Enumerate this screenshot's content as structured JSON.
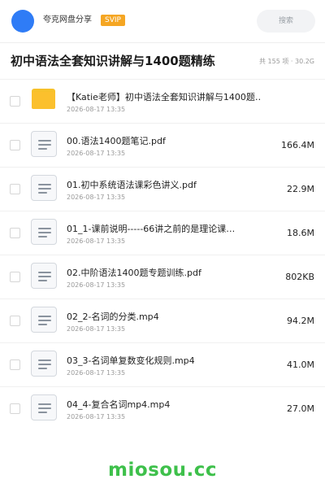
{
  "header": {
    "user_name": "夸克网盘分享",
    "badge": "SVIP",
    "search_placeholder": "搜索",
    "avatar_color": "#2f7cf6",
    "badge_color": "#f5a623"
  },
  "page": {
    "title": "初中语法全套知识讲解与1400题精练",
    "summary": "共 155 项 · 30.2G"
  },
  "files": [
    {
      "type": "folder",
      "icon": "folder-icon",
      "name": "【Katie老师】初中语法全套知识讲解与1400题…",
      "date": "2026-08-17 13:35",
      "size": ""
    },
    {
      "type": "file",
      "icon": "document-icon",
      "name": "00.语法1400题笔记.pdf",
      "date": "2026-08-17 13:35",
      "size": "166.4M"
    },
    {
      "type": "file",
      "icon": "document-icon",
      "name": "01.初中系统语法课彩色讲义.pdf",
      "date": "2026-08-17 13:35",
      "size": "22.9M"
    },
    {
      "type": "file",
      "icon": "document-icon",
      "name": "01_1-课前说明-----66讲之前的是理论课…",
      "date": "2026-08-17 13:35",
      "size": "18.6M"
    },
    {
      "type": "file",
      "icon": "document-icon",
      "name": "02.中阶语法1400题专题训练.pdf",
      "date": "2026-08-17 13:35",
      "size": "802KB"
    },
    {
      "type": "file",
      "icon": "document-icon",
      "name": "02_2-名词的分类.mp4",
      "date": "2026-08-17 13:35",
      "size": "94.2M"
    },
    {
      "type": "file",
      "icon": "document-icon",
      "name": "03_3-名词单复数变化规则.mp4",
      "date": "2026-08-17 13:35",
      "size": "41.0M"
    },
    {
      "type": "file",
      "icon": "document-icon",
      "name": "04_4-复合名词mp4.mp4",
      "date": "2026-08-17 13:35",
      "size": "27.0M"
    }
  ],
  "watermark": "miosou.cc"
}
